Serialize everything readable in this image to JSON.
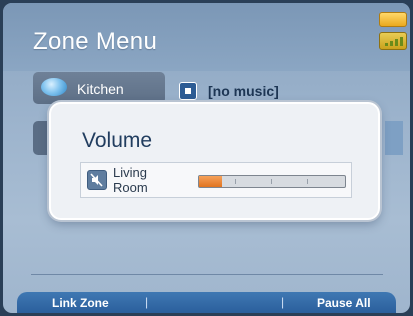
{
  "header": {
    "title": "Zone Menu"
  },
  "zones": [
    {
      "label": "Kitchen",
      "status": "[no music]"
    }
  ],
  "volume_popup": {
    "title": "Volume",
    "zone_label": "Living Room",
    "level": 0.16
  },
  "bottom_bar": {
    "left_label": "Link Zone",
    "right_label": "Pause All",
    "separator": "|"
  },
  "colors": {
    "accent": "#2b5f9c",
    "slider_fill": "#e07420",
    "battery": "#e9a91d"
  }
}
